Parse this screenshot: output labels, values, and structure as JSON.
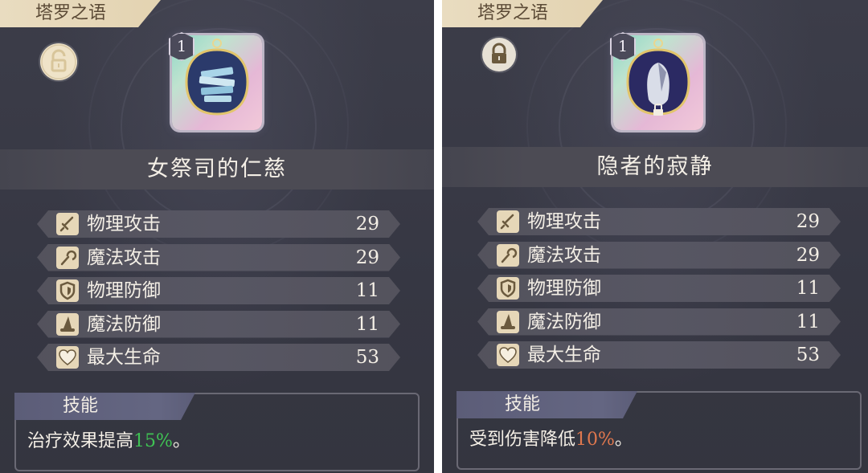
{
  "cards": [
    {
      "tab_title": "塔罗之语",
      "lock_state": "unlocked",
      "lock_icon": "unlock-icon",
      "level": "1",
      "item_icon": "books-card-icon",
      "name": "女祭司的仁慈",
      "stats": [
        {
          "icon": "sword-icon",
          "label": "物理攻击",
          "value": "29"
        },
        {
          "icon": "staff-icon",
          "label": "魔法攻击",
          "value": "29"
        },
        {
          "icon": "shield-icon",
          "label": "物理防御",
          "value": "11"
        },
        {
          "icon": "wizard-hat-icon",
          "label": "魔法防御",
          "value": "11"
        },
        {
          "icon": "heart-icon",
          "label": "最大生命",
          "value": "53"
        }
      ],
      "skill": {
        "title": "技能",
        "text_before": "治疗效果提高",
        "highlight": "15%",
        "text_after": "。",
        "highlight_color": "#3fc254"
      }
    },
    {
      "tab_title": "塔罗之语",
      "lock_state": "locked",
      "lock_icon": "lock-icon",
      "level": "1",
      "item_icon": "hermit-card-icon",
      "name": "隐者的寂静",
      "stats": [
        {
          "icon": "sword-icon",
          "label": "物理攻击",
          "value": "29"
        },
        {
          "icon": "staff-icon",
          "label": "魔法攻击",
          "value": "29"
        },
        {
          "icon": "shield-icon",
          "label": "物理防御",
          "value": "11"
        },
        {
          "icon": "wizard-hat-icon",
          "label": "魔法防御",
          "value": "11"
        },
        {
          "icon": "heart-icon",
          "label": "最大生命",
          "value": "53"
        }
      ],
      "skill": {
        "title": "技能",
        "text_before": "受到伤害降低",
        "highlight": "10%",
        "text_after": "。",
        "highlight_color": "#e0784e"
      }
    }
  ],
  "colors": {
    "panel_bg": "#383944",
    "tab_bg": "#e6d8ba",
    "stat_row_bg": "#575663",
    "text": "#f4efe6"
  }
}
